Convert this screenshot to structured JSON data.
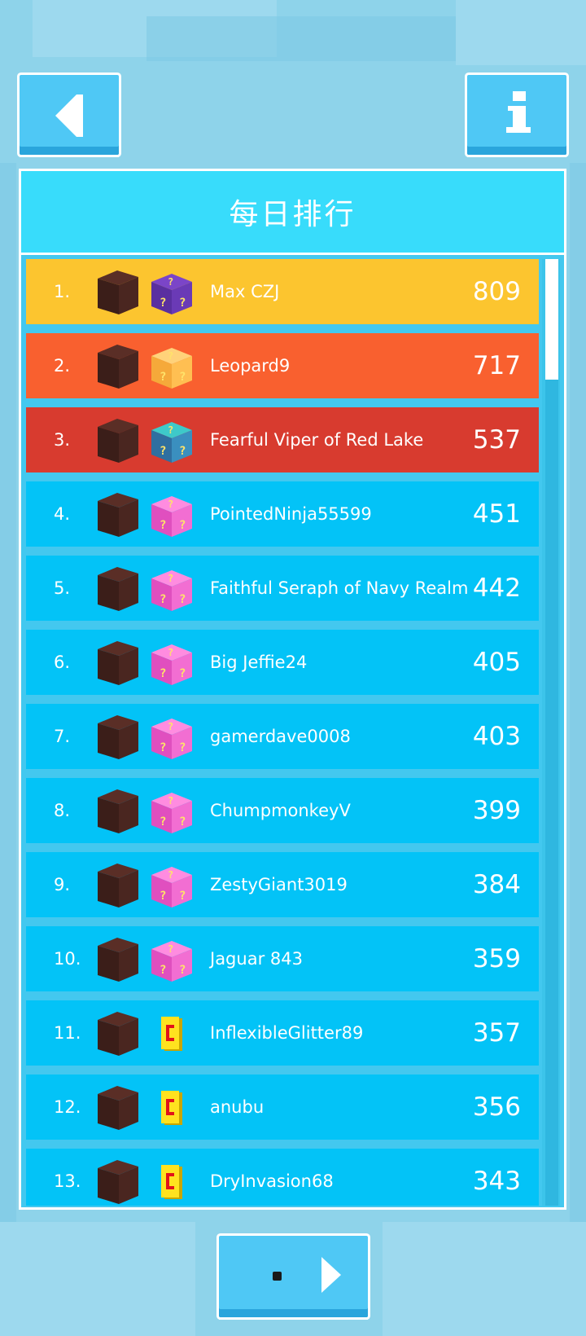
{
  "header": {
    "title": "每日排行"
  },
  "buttons": {
    "back_icon": "arrow-left-icon",
    "info_icon": "info-icon",
    "next_icon": "arrow-right-icon"
  },
  "colors": {
    "gold": "#fcc52f",
    "silver": "#f9602f",
    "bronze": "#d83b2f",
    "regular": "#03c3f7"
  },
  "leaderboard": [
    {
      "rank": "1.",
      "name": "Max CZJ",
      "score": "809",
      "row_color": "#fcc52f",
      "prize": "purple-mystery-box-icon"
    },
    {
      "rank": "2.",
      "name": "Leopard9",
      "score": "717",
      "row_color": "#f9602f",
      "prize": "gold-mystery-box-icon"
    },
    {
      "rank": "3.",
      "name": "Fearful Viper of Red Lake",
      "score": "537",
      "row_color": "#d83b2f",
      "prize": "teal-mystery-box-icon"
    },
    {
      "rank": "4.",
      "name": "PointedNinja55599",
      "score": "451",
      "row_color": "#03c3f7",
      "prize": "pink-mystery-box-icon"
    },
    {
      "rank": "5.",
      "name": "Faithful Seraph of Navy Realm",
      "score": "442",
      "row_color": "#03c3f7",
      "prize": "pink-mystery-box-icon"
    },
    {
      "rank": "6.",
      "name": "Big Jeffie24",
      "score": "405",
      "row_color": "#03c3f7",
      "prize": "pink-mystery-box-icon"
    },
    {
      "rank": "7.",
      "name": "gamerdave0008",
      "score": "403",
      "row_color": "#03c3f7",
      "prize": "pink-mystery-box-icon"
    },
    {
      "rank": "8.",
      "name": "ChumpmonkeyV",
      "score": "399",
      "row_color": "#03c3f7",
      "prize": "pink-mystery-box-icon"
    },
    {
      "rank": "9.",
      "name": "ZestyGiant3019",
      "score": "384",
      "row_color": "#03c3f7",
      "prize": "pink-mystery-box-icon"
    },
    {
      "rank": "10.",
      "name": "Jaguar 843",
      "score": "359",
      "row_color": "#03c3f7",
      "prize": "pink-mystery-box-icon"
    },
    {
      "rank": "11.",
      "name": "InflexibleGlitter89",
      "score": "357",
      "row_color": "#03c3f7",
      "prize": "coin-icon"
    },
    {
      "rank": "12.",
      "name": "anubu",
      "score": "356",
      "row_color": "#03c3f7",
      "prize": "coin-icon"
    },
    {
      "rank": "13.",
      "name": "DryInvasion68",
      "score": "343",
      "row_color": "#03c3f7",
      "prize": "coin-icon"
    }
  ]
}
